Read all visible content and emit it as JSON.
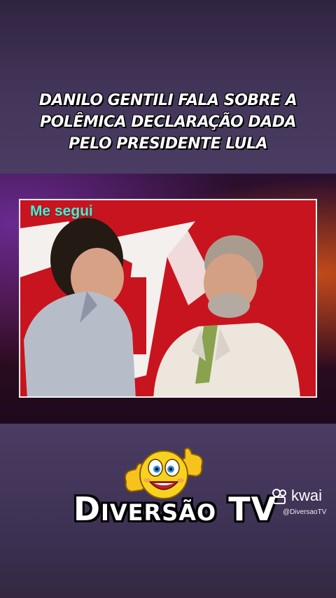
{
  "headline": {
    "line1": "DANILO GENTILI FALA SOBRE A",
    "line2": "POLÊMICA DECLARAÇÃO DADA",
    "line3": "PELO PRESIDENTE LULA"
  },
  "video": {
    "watermark_text": "Me segui"
  },
  "brand": {
    "name": "Diversão TV",
    "emoji_icon": "thumbs-up-smiley-icon"
  },
  "kwai": {
    "logo_icon": "kwai-logo-icon",
    "name": "kwai",
    "handle": "@DiversaoTV"
  },
  "colors": {
    "background": "#3c2f50",
    "video_red": "#c8141e",
    "watermark": "#3ff0d6"
  }
}
